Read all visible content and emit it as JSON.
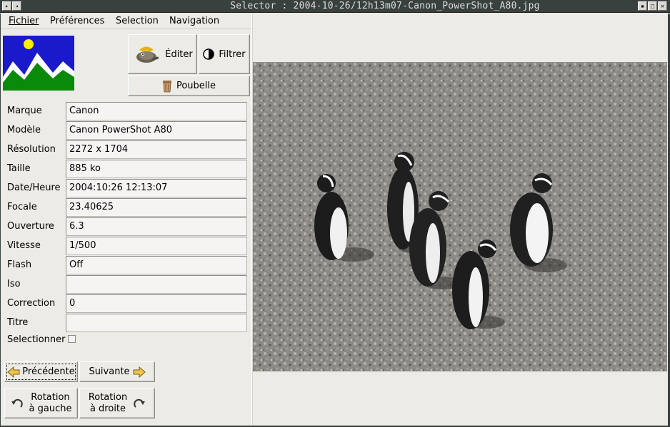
{
  "window": {
    "title": "Selector : 2004-10-26/12h13m07-Canon_PowerShot_A80.jpg"
  },
  "menu": {
    "file": "Fichier",
    "prefs": "Préférences",
    "selection": "Selection",
    "navigation": "Navigation"
  },
  "toolbar": {
    "edit_label": "Éditer",
    "filter_label": "Filtrer",
    "trash_label": "Poubelle"
  },
  "exif": [
    {
      "label": "Marque",
      "value": "Canon"
    },
    {
      "label": "Modèle",
      "value": "Canon PowerShot A80"
    },
    {
      "label": "Résolution",
      "value": "2272 x 1704"
    },
    {
      "label": "Taille",
      "value": "885 ko"
    },
    {
      "label": "Date/Heure",
      "value": "2004:10:26 12:13:07"
    },
    {
      "label": "Focale",
      "value": "23.40625"
    },
    {
      "label": "Ouverture",
      "value": "6.3"
    },
    {
      "label": "Vitesse",
      "value": "1/500"
    },
    {
      "label": "Flash",
      "value": "Off"
    },
    {
      "label": "Iso",
      "value": ""
    },
    {
      "label": "Correction",
      "value": "0"
    },
    {
      "label": "Titre",
      "value": ""
    }
  ],
  "select": {
    "label": "Selectionner",
    "checked": false
  },
  "nav": {
    "prev": "Précédente",
    "next": "Suivante"
  },
  "rotate": {
    "left_line1": "Rotation",
    "left_line2": "à gauche",
    "right_line1": "Rotation",
    "right_line2": "à droite"
  }
}
